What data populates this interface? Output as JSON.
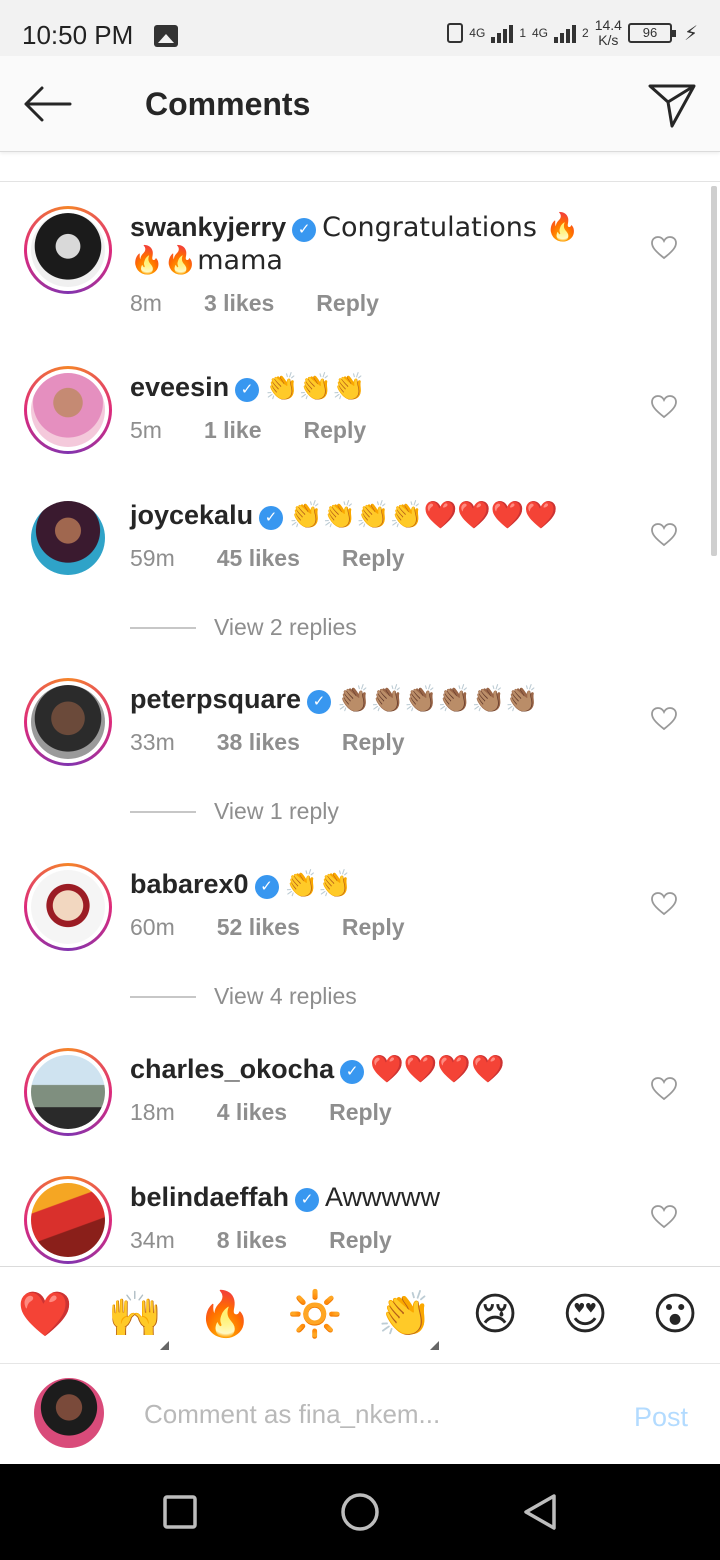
{
  "status_bar": {
    "time": "10:50 PM",
    "network1": "4G",
    "network2": "4G",
    "sim1": "1",
    "sim2": "2",
    "speed_value": "14.4",
    "speed_unit": "K/s",
    "battery": "96"
  },
  "header": {
    "title": "Comments"
  },
  "comments": [
    {
      "username": "swankyjerry",
      "text": "Congratulations 🔥🔥🔥mama",
      "time": "8m",
      "likes": "3 likes",
      "reply": "Reply"
    },
    {
      "username": "eveesin",
      "text": "👏👏👏",
      "time": "5m",
      "likes": "1 like",
      "reply": "Reply"
    },
    {
      "username": "joycekalu",
      "text": "👏👏👏👏❤️❤️❤️❤️",
      "time": "59m",
      "likes": "45 likes",
      "reply": "Reply",
      "view_replies": "View 2 replies"
    },
    {
      "username": "peterpsquare",
      "text": "👏🏽👏🏽👏🏽👏🏽👏🏽👏🏽",
      "time": "33m",
      "likes": "38 likes",
      "reply": "Reply",
      "view_replies": "View 1 reply"
    },
    {
      "username": "babarex0",
      "text": "👏👏",
      "time": "60m",
      "likes": "52 likes",
      "reply": "Reply",
      "view_replies": "View 4 replies"
    },
    {
      "username": "charles_okocha",
      "text": "❤️❤️❤️❤️",
      "time": "18m",
      "likes": "4 likes",
      "reply": "Reply"
    },
    {
      "username": "belindaeffah",
      "text": "Awwwww",
      "time": "34m",
      "likes": "8 likes",
      "reply": "Reply"
    }
  ],
  "quick_emojis": [
    "❤️",
    "🙌",
    "🔥",
    "🔆",
    "👏",
    "😢",
    "😍",
    "😮"
  ],
  "input": {
    "placeholder": "Comment as fina_nkem...",
    "post_label": "Post"
  },
  "colors": {
    "accent": "#3897f0",
    "post_disabled": "#b3dbff",
    "meta_gray": "#8e8e8e"
  }
}
